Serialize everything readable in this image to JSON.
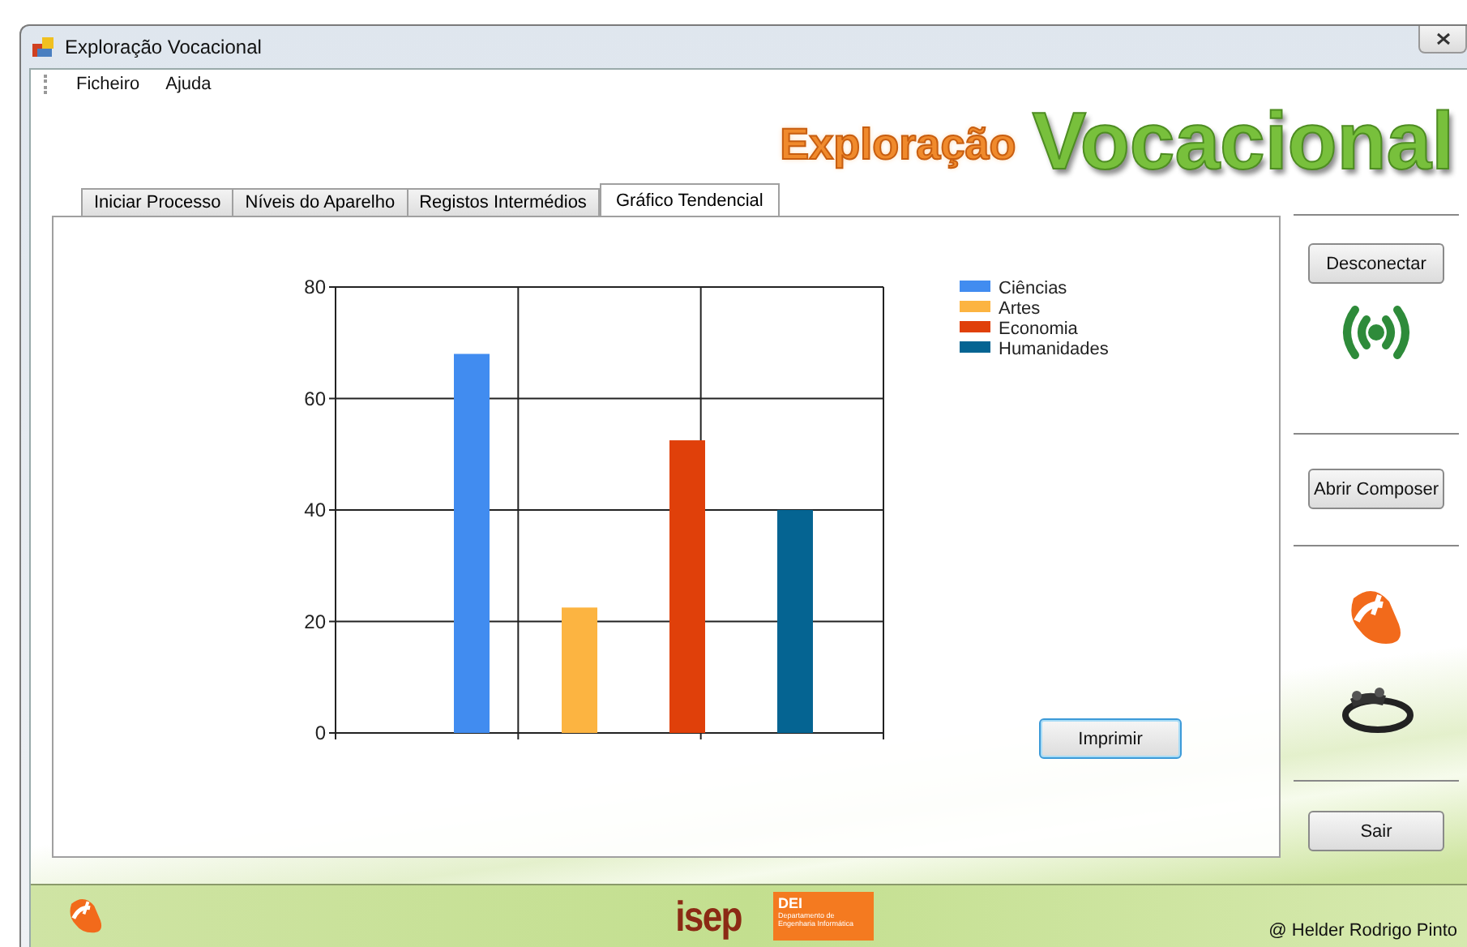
{
  "window": {
    "title": "Exploração Vocacional"
  },
  "menu": [
    "Ficheiro",
    "Ajuda"
  ],
  "logo": {
    "small": "Exploração",
    "large": "Vocacional"
  },
  "tabs": [
    {
      "label": "Iniciar Processo",
      "selected": false
    },
    {
      "label": "Níveis do Aparelho",
      "selected": false
    },
    {
      "label": "Registos Intermédios",
      "selected": false
    },
    {
      "label": "Gráfico Tendencial",
      "selected": true
    }
  ],
  "chart": {
    "chart_data": {
      "type": "bar",
      "grid": true,
      "legend": "top-right",
      "ylim": [
        0,
        80
      ],
      "yticks": [
        0,
        20,
        40,
        60,
        80
      ],
      "series": [
        {
          "name": "Ciências",
          "color": "#418cf0",
          "values": [
            68
          ]
        },
        {
          "name": "Artes",
          "color": "#fcb441",
          "values": [
            22.5
          ]
        },
        {
          "name": "Economia",
          "color": "#e0400a",
          "values": [
            52.5
          ]
        },
        {
          "name": "Humanidades",
          "color": "#056492",
          "values": [
            40
          ]
        }
      ]
    },
    "print_button": "Imprimir"
  },
  "side_panel": {
    "connect_button": "Desconectar",
    "composer_button": "Abrir Composer",
    "exit_button": "Sair"
  },
  "footer": {
    "isep": "isep",
    "dei": "DEI",
    "dei_subtitle": "Departamento de Engenharia Informática",
    "credit": "@ Helder Rodrigo Pinto"
  }
}
